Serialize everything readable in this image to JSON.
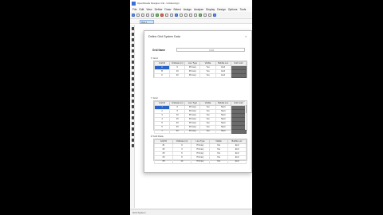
{
  "window": {
    "title": "OpenRoads Designer CE - Untitled.dgn"
  },
  "menu": [
    "File",
    "Edit",
    "View",
    "Define",
    "Draw",
    "Select",
    "Assign",
    "Analyze",
    "Display",
    "Design",
    "Options",
    "Tools"
  ],
  "tab": {
    "label": "View 1"
  },
  "status": {
    "text": "Grid System"
  },
  "dialog": {
    "title": "Define Grid System Data",
    "close_glyph": "×",
    "name_label": "Grid Name",
    "name_value": "Grid1"
  },
  "x_grid": {
    "label": "X Grid",
    "headers": [
      "Grid ID",
      "Ordinate (m)",
      "Line Type",
      "Visible",
      "Bubble Loc",
      "Grid Color"
    ],
    "rows": [
      [
        "A",
        "0",
        "Primary",
        "Yes",
        "End"
      ],
      [
        "B",
        "10",
        "Primary",
        "Yes",
        "End"
      ],
      [
        "C",
        "20",
        "Primary",
        "Yes",
        "End"
      ]
    ]
  },
  "y_grid": {
    "label": "Y Grid",
    "headers": [
      "Grid ID",
      "Ordinate (m)",
      "Line Type",
      "Visible",
      "Bubble Loc",
      "Grid Color"
    ],
    "rows": [
      [
        "1",
        "0",
        "Primary",
        "Yes",
        "Start"
      ],
      [
        "2",
        "5",
        "Primary",
        "Yes",
        "Start"
      ],
      [
        "3",
        "10",
        "Primary",
        "Yes",
        "Start"
      ],
      [
        "4",
        "15",
        "Primary",
        "Yes",
        "Start"
      ],
      [
        "5",
        "20",
        "Primary",
        "Yes",
        "Start"
      ],
      [
        "6",
        "25",
        "Primary",
        "Yes",
        "Start"
      ],
      [
        "7",
        "30",
        "Primary",
        "Yes",
        "Start"
      ]
    ]
  },
  "z_grid": {
    "label": "Z Grid Data",
    "headers": [
      "Grid ID",
      "Ordinate (m)",
      "Line Type",
      "Visible",
      "Bubble Loc"
    ],
    "rows": [
      [
        "Z1",
        "0",
        "Primary",
        "Yes",
        "End"
      ],
      [
        "Z2",
        "3",
        "Primary",
        "Yes",
        "End"
      ],
      [
        "Z3",
        "6",
        "Primary",
        "Yes",
        "End"
      ],
      [
        "Z4",
        "9",
        "Primary",
        "Yes",
        "End"
      ],
      [
        "Z5",
        "12",
        "Primary",
        "Yes",
        "End"
      ]
    ]
  }
}
